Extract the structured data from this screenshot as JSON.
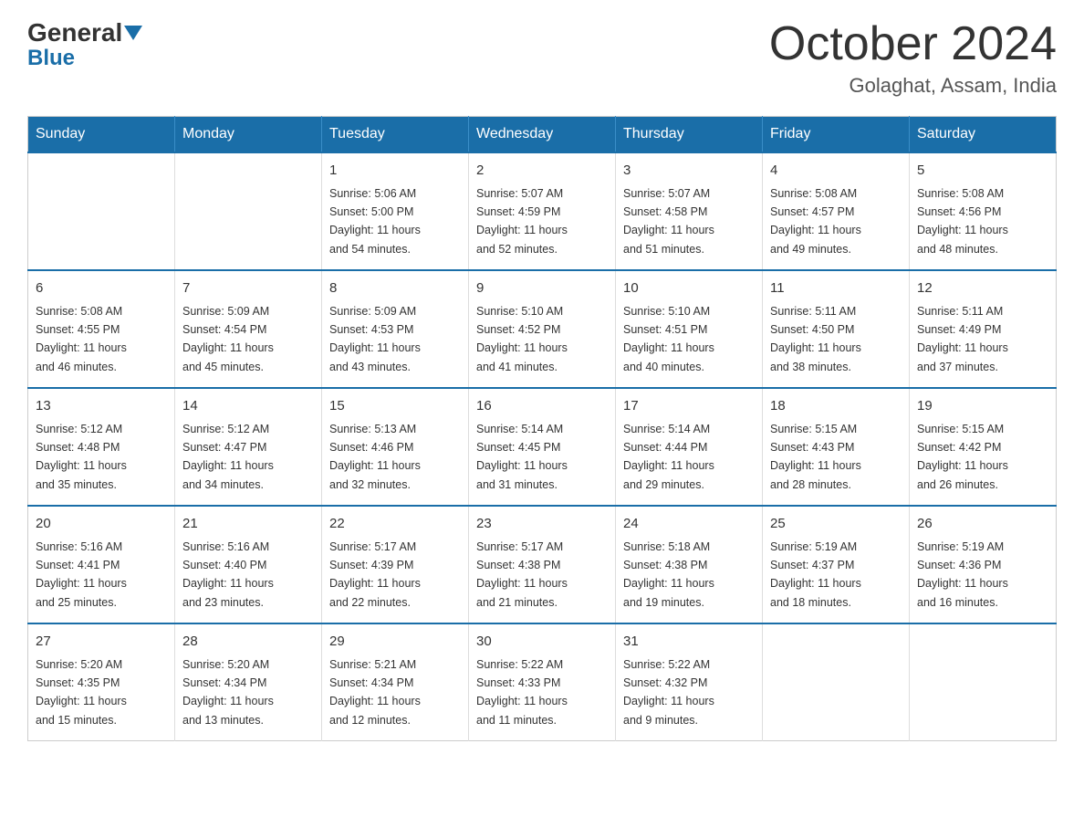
{
  "header": {
    "logo_general": "General",
    "logo_blue": "Blue",
    "month_title": "October 2024",
    "location": "Golaghat, Assam, India"
  },
  "days_of_week": [
    "Sunday",
    "Monday",
    "Tuesday",
    "Wednesday",
    "Thursday",
    "Friday",
    "Saturday"
  ],
  "weeks": [
    [
      {
        "day": "",
        "info": ""
      },
      {
        "day": "",
        "info": ""
      },
      {
        "day": "1",
        "info": "Sunrise: 5:06 AM\nSunset: 5:00 PM\nDaylight: 11 hours\nand 54 minutes."
      },
      {
        "day": "2",
        "info": "Sunrise: 5:07 AM\nSunset: 4:59 PM\nDaylight: 11 hours\nand 52 minutes."
      },
      {
        "day": "3",
        "info": "Sunrise: 5:07 AM\nSunset: 4:58 PM\nDaylight: 11 hours\nand 51 minutes."
      },
      {
        "day": "4",
        "info": "Sunrise: 5:08 AM\nSunset: 4:57 PM\nDaylight: 11 hours\nand 49 minutes."
      },
      {
        "day": "5",
        "info": "Sunrise: 5:08 AM\nSunset: 4:56 PM\nDaylight: 11 hours\nand 48 minutes."
      }
    ],
    [
      {
        "day": "6",
        "info": "Sunrise: 5:08 AM\nSunset: 4:55 PM\nDaylight: 11 hours\nand 46 minutes."
      },
      {
        "day": "7",
        "info": "Sunrise: 5:09 AM\nSunset: 4:54 PM\nDaylight: 11 hours\nand 45 minutes."
      },
      {
        "day": "8",
        "info": "Sunrise: 5:09 AM\nSunset: 4:53 PM\nDaylight: 11 hours\nand 43 minutes."
      },
      {
        "day": "9",
        "info": "Sunrise: 5:10 AM\nSunset: 4:52 PM\nDaylight: 11 hours\nand 41 minutes."
      },
      {
        "day": "10",
        "info": "Sunrise: 5:10 AM\nSunset: 4:51 PM\nDaylight: 11 hours\nand 40 minutes."
      },
      {
        "day": "11",
        "info": "Sunrise: 5:11 AM\nSunset: 4:50 PM\nDaylight: 11 hours\nand 38 minutes."
      },
      {
        "day": "12",
        "info": "Sunrise: 5:11 AM\nSunset: 4:49 PM\nDaylight: 11 hours\nand 37 minutes."
      }
    ],
    [
      {
        "day": "13",
        "info": "Sunrise: 5:12 AM\nSunset: 4:48 PM\nDaylight: 11 hours\nand 35 minutes."
      },
      {
        "day": "14",
        "info": "Sunrise: 5:12 AM\nSunset: 4:47 PM\nDaylight: 11 hours\nand 34 minutes."
      },
      {
        "day": "15",
        "info": "Sunrise: 5:13 AM\nSunset: 4:46 PM\nDaylight: 11 hours\nand 32 minutes."
      },
      {
        "day": "16",
        "info": "Sunrise: 5:14 AM\nSunset: 4:45 PM\nDaylight: 11 hours\nand 31 minutes."
      },
      {
        "day": "17",
        "info": "Sunrise: 5:14 AM\nSunset: 4:44 PM\nDaylight: 11 hours\nand 29 minutes."
      },
      {
        "day": "18",
        "info": "Sunrise: 5:15 AM\nSunset: 4:43 PM\nDaylight: 11 hours\nand 28 minutes."
      },
      {
        "day": "19",
        "info": "Sunrise: 5:15 AM\nSunset: 4:42 PM\nDaylight: 11 hours\nand 26 minutes."
      }
    ],
    [
      {
        "day": "20",
        "info": "Sunrise: 5:16 AM\nSunset: 4:41 PM\nDaylight: 11 hours\nand 25 minutes."
      },
      {
        "day": "21",
        "info": "Sunrise: 5:16 AM\nSunset: 4:40 PM\nDaylight: 11 hours\nand 23 minutes."
      },
      {
        "day": "22",
        "info": "Sunrise: 5:17 AM\nSunset: 4:39 PM\nDaylight: 11 hours\nand 22 minutes."
      },
      {
        "day": "23",
        "info": "Sunrise: 5:17 AM\nSunset: 4:38 PM\nDaylight: 11 hours\nand 21 minutes."
      },
      {
        "day": "24",
        "info": "Sunrise: 5:18 AM\nSunset: 4:38 PM\nDaylight: 11 hours\nand 19 minutes."
      },
      {
        "day": "25",
        "info": "Sunrise: 5:19 AM\nSunset: 4:37 PM\nDaylight: 11 hours\nand 18 minutes."
      },
      {
        "day": "26",
        "info": "Sunrise: 5:19 AM\nSunset: 4:36 PM\nDaylight: 11 hours\nand 16 minutes."
      }
    ],
    [
      {
        "day": "27",
        "info": "Sunrise: 5:20 AM\nSunset: 4:35 PM\nDaylight: 11 hours\nand 15 minutes."
      },
      {
        "day": "28",
        "info": "Sunrise: 5:20 AM\nSunset: 4:34 PM\nDaylight: 11 hours\nand 13 minutes."
      },
      {
        "day": "29",
        "info": "Sunrise: 5:21 AM\nSunset: 4:34 PM\nDaylight: 11 hours\nand 12 minutes."
      },
      {
        "day": "30",
        "info": "Sunrise: 5:22 AM\nSunset: 4:33 PM\nDaylight: 11 hours\nand 11 minutes."
      },
      {
        "day": "31",
        "info": "Sunrise: 5:22 AM\nSunset: 4:32 PM\nDaylight: 11 hours\nand 9 minutes."
      },
      {
        "day": "",
        "info": ""
      },
      {
        "day": "",
        "info": ""
      }
    ]
  ]
}
